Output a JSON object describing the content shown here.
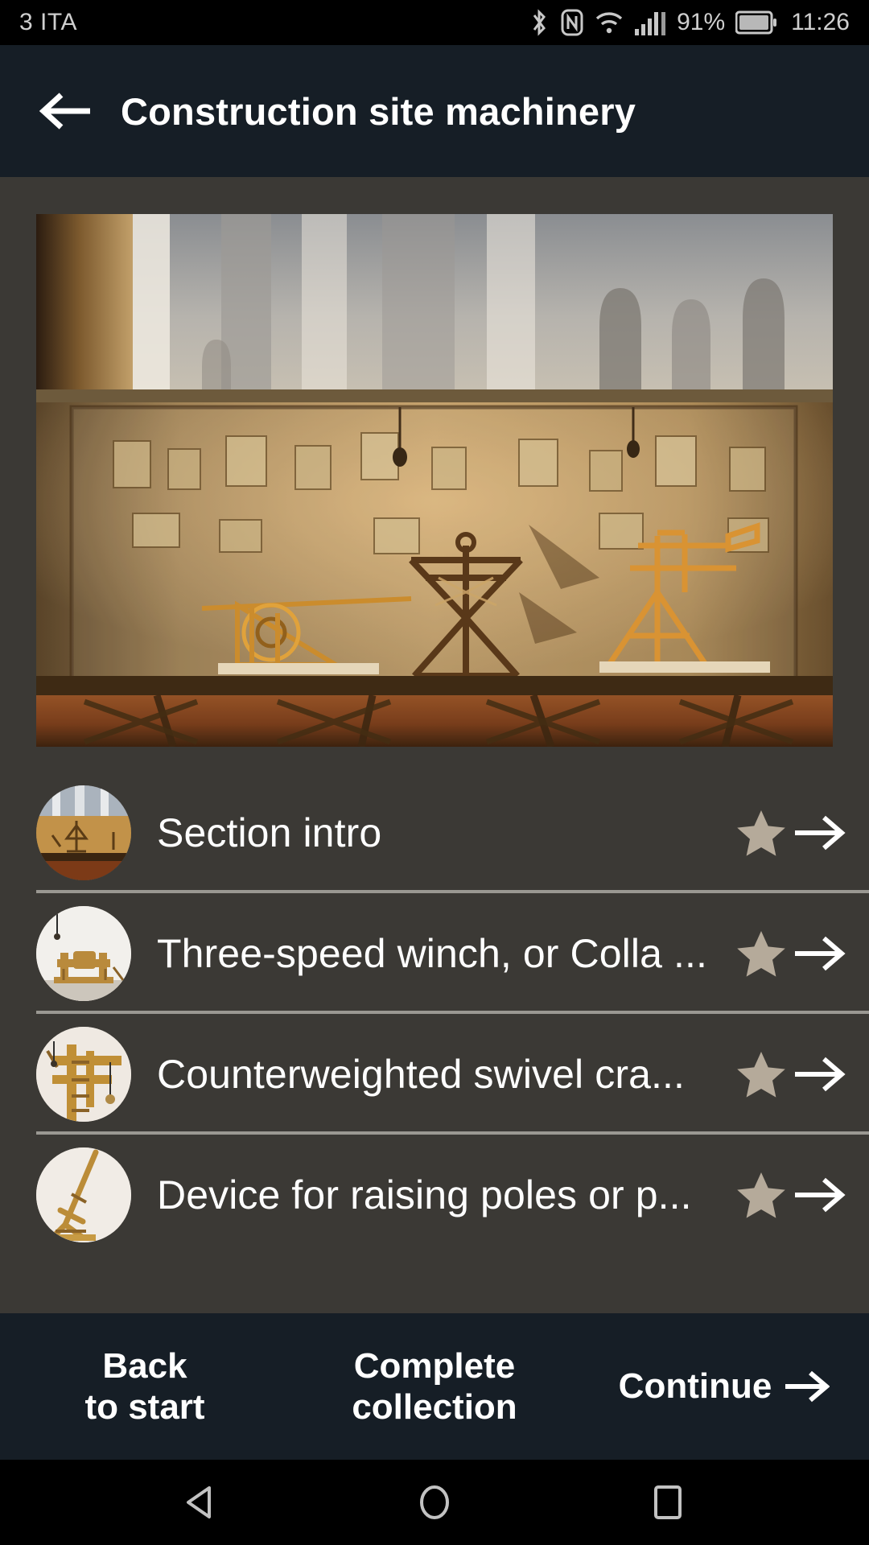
{
  "status_bar": {
    "carrier": "3 ITA",
    "battery_percent": "91%",
    "clock": "11:26",
    "icons": [
      "bluetooth-icon",
      "nfc-icon",
      "wifi-icon",
      "cellular-signal-icon",
      "battery-icon"
    ]
  },
  "app_bar": {
    "back_label": "back-arrow-icon",
    "title": "Construction site machinery"
  },
  "hero": {
    "alt": "Museum display case with wooden construction machinery models under warm lighting"
  },
  "list": {
    "items": [
      {
        "label": "Section intro",
        "thumb": "museum-display-case",
        "star": "star-icon",
        "arrow": "arrow-right-icon"
      },
      {
        "label": "Three-speed winch, or Colla ...",
        "thumb": "wooden-winch",
        "star": "star-icon",
        "arrow": "arrow-right-icon"
      },
      {
        "label": "Counterweighted swivel cra...",
        "thumb": "swivel-crane",
        "star": "star-icon",
        "arrow": "arrow-right-icon"
      },
      {
        "label": "Device for raising poles or p...",
        "thumb": "pole-raising-device",
        "star": "star-icon",
        "arrow": "arrow-right-icon"
      }
    ]
  },
  "action_bar": {
    "back_to_start_line1": "Back",
    "back_to_start_line2": "to start",
    "complete_collection_line1": "Complete",
    "complete_collection_line2": "collection",
    "continue_label": "Continue"
  },
  "nav_bar": {
    "back": "triangle-back-icon",
    "home": "circle-home-icon",
    "recents": "square-recents-icon"
  },
  "colors": {
    "app_bar_bg": "#161e26",
    "content_bg": "#3b3935",
    "status_bar_bg": "#000000",
    "star": "#b5aa9a",
    "divider": "#9a9892",
    "text_primary": "#ffffff"
  }
}
